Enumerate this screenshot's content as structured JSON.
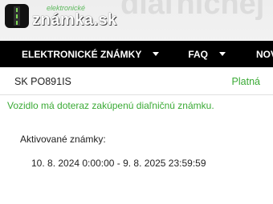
{
  "logo": {
    "small_text": "elektronické",
    "main_text": "známka.sk"
  },
  "nav": {
    "items": [
      {
        "label": "ELEKTRONICKÉ ZNÁMKY",
        "has_dropdown": true
      },
      {
        "label": "FAQ",
        "has_dropdown": true
      },
      {
        "label": "NOVINKY",
        "has_dropdown": false
      }
    ]
  },
  "result": {
    "plate": "SK PO891IS",
    "status": "Platná",
    "message": "Vozidlo má doteraz zakúpenú diaľničnú známku.",
    "activated_label": "Aktivované známky:",
    "activated_range": "10. 8. 2024 0:00:00 - 9. 8. 2025 23:59:59"
  },
  "colors": {
    "valid_green": "#3aaa35",
    "navbar": "#000000"
  },
  "icons": {
    "logo": "road-icon",
    "dropdown": "caret-down-icon"
  }
}
